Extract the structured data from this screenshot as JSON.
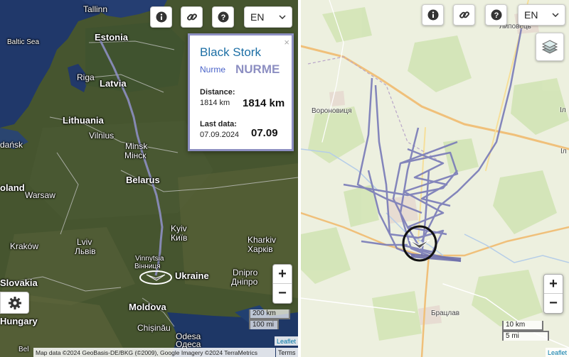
{
  "left_map": {
    "labels": {
      "tallinn": "Tallinn",
      "estonia": "Estonia",
      "baltic_sea": "Baltic Sea",
      "riga": "Riga",
      "latvia": "Latvia",
      "lithuania": "Lithuania",
      "vilnius": "Vilnius",
      "gdansk": "dańsk",
      "minsk": "Minsk",
      "minsk_cyr": "Мінск",
      "belarus": "Belarus",
      "oland": "oland",
      "warsaw": "Warsaw",
      "kyiv": "Kyiv",
      "kyiv_cyr": "Київ",
      "kharkiv": "Kharkiv",
      "kharkiv_cyr": "Харків",
      "lviv": "Lviv",
      "lviv_cyr": "Львів",
      "krakow": "Kraków",
      "vinnytsia": "Vinnytsia",
      "vinnytsia_cyr": "Вінниця",
      "ukraine": "Ukraine",
      "dnipro": "Dnipro",
      "dnipro_cyr": "Дніпро",
      "slovakia": "Slovakia",
      "moldova": "Moldova",
      "hungary": "Hungary",
      "chisinau": "Chișinău",
      "odesa": "Odesa",
      "odesa_cyr": "Одеса",
      "bel": "Bel"
    },
    "scale_km": "200 km",
    "scale_mi": "100 mi",
    "leaflet": "Leaflet",
    "attribution": "Map data ©2024 GeoBasis-DE/BKG (©2009), Google Imagery ©2024 TerraMetrics",
    "terms": "Terms",
    "zoom_in": "+",
    "zoom_out": "−",
    "language": "EN"
  },
  "popup": {
    "close": "×",
    "species": "Black Stork",
    "bird_name_small": "Nurme",
    "bird_name_big": "NURME",
    "distance_label": "Distance:",
    "distance_value_small": "1814 km",
    "distance_value_big": "1814 km",
    "lastdata_label": "Last data:",
    "lastdata_value_small": "07.09.2024",
    "lastdata_value_big": "07.09"
  },
  "right_map": {
    "labels": {
      "lypovets": "Липовець",
      "voronovytsia": "Вороновиця",
      "braclav": "Брацлав",
      "ill1": "Іл",
      "ill2": "Іл"
    },
    "scale_km": "10 km",
    "scale_mi": "5 mi",
    "leaflet": "Leaflet",
    "zoom_in": "+",
    "zoom_out": "−",
    "language": "EN"
  },
  "icons": [
    "info-icon",
    "link-icon",
    "help-icon",
    "chevron-down-icon",
    "gear-icon",
    "layers-icon",
    "stork-icon"
  ],
  "colors": {
    "track": "#8d8fc2",
    "popup_border": "#8d8fc2",
    "leaflet_link": "#0078a8"
  }
}
